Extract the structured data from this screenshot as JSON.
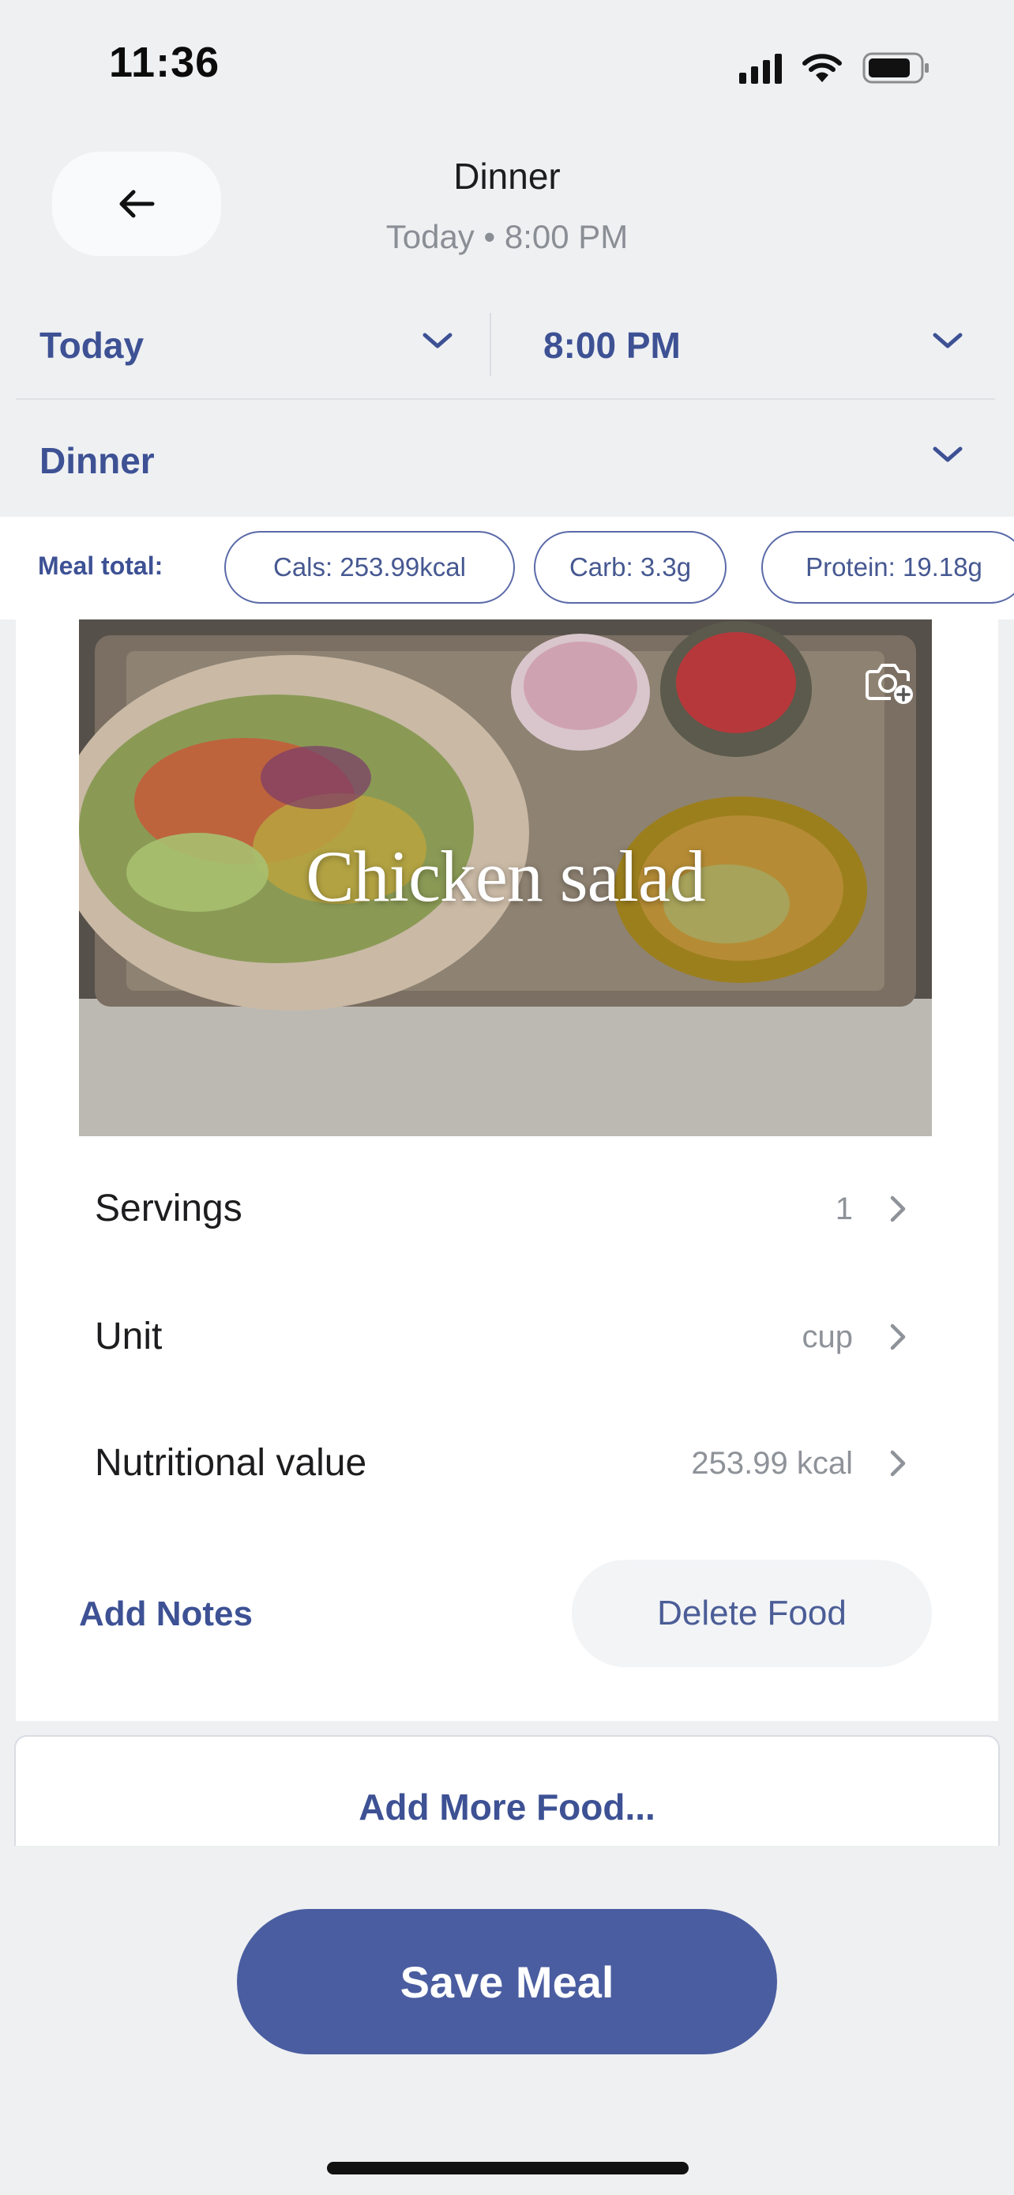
{
  "status_bar": {
    "time": "11:36",
    "icons": [
      "cellular-signal-icon",
      "wifi-icon",
      "battery-icon"
    ]
  },
  "header": {
    "back_icon": "arrow-left-icon",
    "title": "Dinner",
    "subtitle": "Today • 8:00 PM"
  },
  "selectors": {
    "date": "Today",
    "time": "8:00 PM",
    "meal": "Dinner"
  },
  "meal_total": {
    "label": "Meal total:",
    "chips": {
      "cals": "Cals: 253.99kcal",
      "carb": "Carb: 3.3g",
      "protein": "Protein: 19.18g"
    }
  },
  "food": {
    "name": "Chicken salad",
    "photo_action_icon": "camera-add-icon",
    "servings_label": "Servings",
    "servings_value": "1",
    "unit_label": "Unit",
    "unit_value": "cup",
    "nutrition_label": "Nutritional value",
    "nutrition_value": "253.99 kcal",
    "add_notes": "Add Notes",
    "delete": "Delete Food"
  },
  "add_more": "Add More Food...",
  "save": "Save Meal",
  "colors": {
    "accent": "#3d5194",
    "save_button": "#4a5da0",
    "background": "#eff0f2"
  }
}
